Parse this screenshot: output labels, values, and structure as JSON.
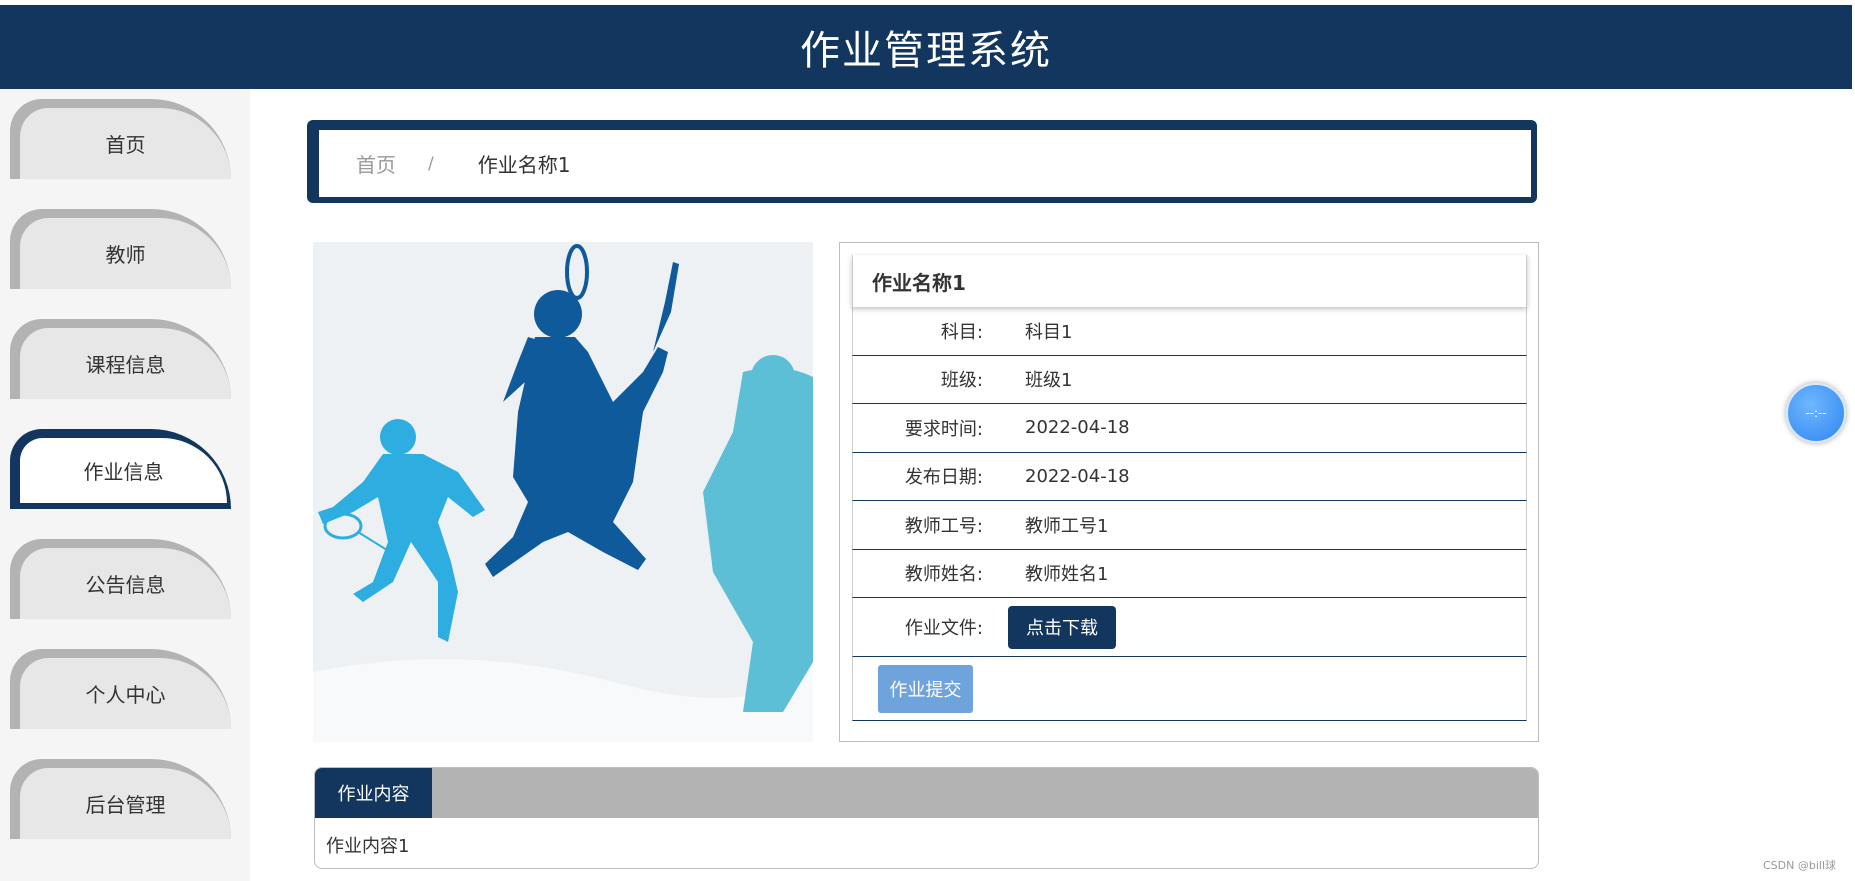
{
  "header": {
    "title": "作业管理系统"
  },
  "sidebar": {
    "items": [
      {
        "label": "首页"
      },
      {
        "label": "教师"
      },
      {
        "label": "课程信息"
      },
      {
        "label": "作业信息"
      },
      {
        "label": "公告信息"
      },
      {
        "label": "个人中心"
      },
      {
        "label": "后台管理"
      }
    ],
    "active": "作业信息"
  },
  "breadcrumb": {
    "home": "首页",
    "separator": "/",
    "current": "作业名称1"
  },
  "detail": {
    "title": "作业名称1",
    "rows": [
      {
        "label": "科目:",
        "value": "科目1"
      },
      {
        "label": "班级:",
        "value": "班级1"
      },
      {
        "label": "要求时间:",
        "value": "2022-04-18"
      },
      {
        "label": "发布日期:",
        "value": "2022-04-18"
      },
      {
        "label": "教师工号:",
        "value": "教师工号1"
      },
      {
        "label": "教师姓名:",
        "value": "教师姓名1"
      }
    ],
    "file_label": "作业文件:",
    "download_label": "点击下载",
    "submit_label": "作业提交"
  },
  "content_tab": {
    "tab_label": "作业内容",
    "body": "作业内容1"
  },
  "float_widget": {
    "text": "--:--"
  },
  "watermark": "CSDN @bill球",
  "colors": {
    "primary": "#12365d",
    "submit": "#6ea3dc",
    "tab_bar": "#b3b3b3"
  }
}
